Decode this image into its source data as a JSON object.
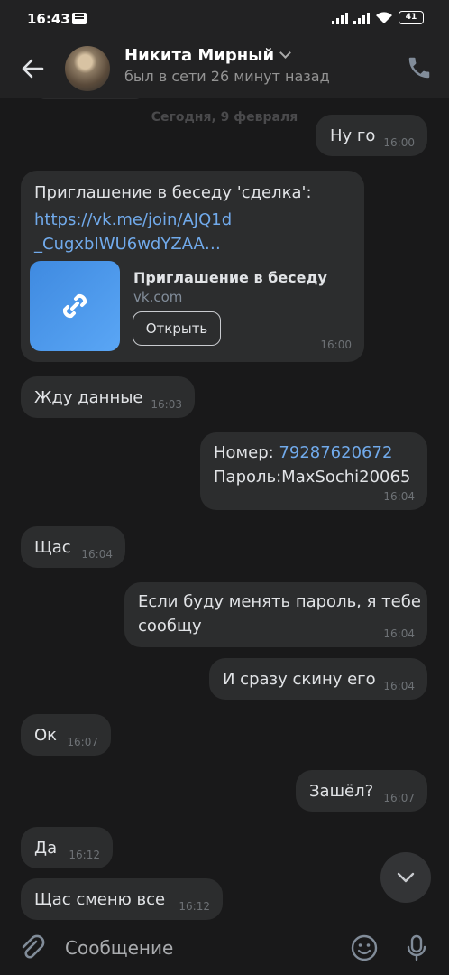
{
  "status_bar": {
    "time": "16:43",
    "battery": "41"
  },
  "header": {
    "name": "Никита Мирный",
    "status": "был в сети 26 минут назад"
  },
  "chat": {
    "date_separator": "Сегодня, 9 февраля",
    "messages": [
      {
        "side": "out",
        "text": "Ну го",
        "time": "16:00"
      },
      {
        "side": "in",
        "text": "Приглашение в беседу 'сделка':",
        "link_line1": "https://vk.me/join/AJQ1d",
        "link_line2": "_CugxbIWU6wdYZAA…",
        "card_title": "Приглашение в беседу",
        "card_domain": "vk.com",
        "card_button": "Открыть",
        "time": "16:00"
      },
      {
        "side": "in",
        "text": "Жду данные",
        "time": "16:03"
      },
      {
        "side": "out",
        "line1_label": "Номер: ",
        "line1_phone": "79287620672",
        "line2": "Пароль:MaxSochi20065",
        "time": "16:04"
      },
      {
        "side": "in",
        "text": "Щас",
        "time": "16:04"
      },
      {
        "side": "out",
        "line1": "Если буду менять пароль, я тебе",
        "line2": "сообщу",
        "time": "16:04"
      },
      {
        "side": "out",
        "text": "И сразу скину его",
        "time": "16:04"
      },
      {
        "side": "in",
        "text": "Ок",
        "time": "16:07"
      },
      {
        "side": "out",
        "text": "Зашёл?",
        "time": "16:07"
      },
      {
        "side": "in",
        "text": "Да",
        "time": "16:12"
      },
      {
        "side": "in",
        "text": "Щас сменю все",
        "time": "16:12"
      }
    ]
  },
  "composer": {
    "placeholder": "Сообщение"
  },
  "colors": {
    "background": "#19191a",
    "bubble": "#2c2d2e",
    "link": "#71aaeb",
    "accent": "#3f8ae0"
  },
  "icons": [
    "back-arrow-icon",
    "phone-icon",
    "link-icon",
    "chevron-down-icon",
    "paperclip-icon",
    "emoji-icon",
    "microphone-icon"
  ]
}
